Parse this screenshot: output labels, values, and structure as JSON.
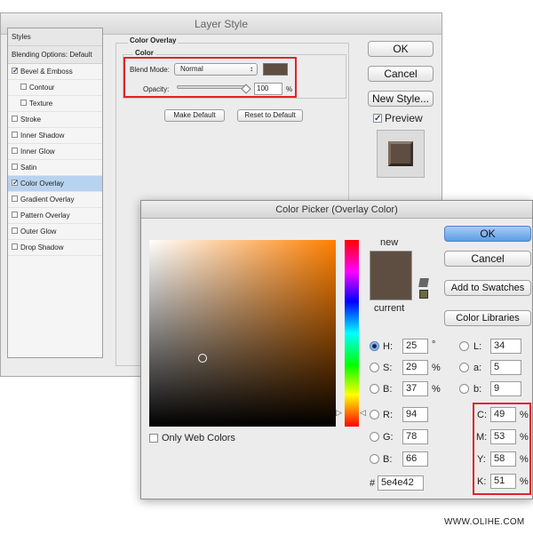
{
  "layer_style": {
    "title": "Layer Style",
    "styles": [
      {
        "label": "Styles",
        "checkbox": false,
        "checked": false,
        "indent": false,
        "selected": false,
        "header": true
      },
      {
        "label": "Blending Options: Default",
        "checkbox": false,
        "checked": false,
        "indent": false,
        "selected": false,
        "header": true
      },
      {
        "label": "Bevel & Emboss",
        "checkbox": true,
        "checked": true,
        "indent": false,
        "selected": false,
        "header": false
      },
      {
        "label": "Contour",
        "checkbox": true,
        "checked": false,
        "indent": true,
        "selected": false,
        "header": false
      },
      {
        "label": "Texture",
        "checkbox": true,
        "checked": false,
        "indent": true,
        "selected": false,
        "header": false
      },
      {
        "label": "Stroke",
        "checkbox": true,
        "checked": false,
        "indent": false,
        "selected": false,
        "header": false
      },
      {
        "label": "Inner Shadow",
        "checkbox": true,
        "checked": false,
        "indent": false,
        "selected": false,
        "header": false
      },
      {
        "label": "Inner Glow",
        "checkbox": true,
        "checked": false,
        "indent": false,
        "selected": false,
        "header": false
      },
      {
        "label": "Satin",
        "checkbox": true,
        "checked": false,
        "indent": false,
        "selected": false,
        "header": false
      },
      {
        "label": "Color Overlay",
        "checkbox": true,
        "checked": true,
        "indent": false,
        "selected": true,
        "header": false
      },
      {
        "label": "Gradient Overlay",
        "checkbox": true,
        "checked": false,
        "indent": false,
        "selected": false,
        "header": false
      },
      {
        "label": "Pattern Overlay",
        "checkbox": true,
        "checked": false,
        "indent": false,
        "selected": false,
        "header": false
      },
      {
        "label": "Outer Glow",
        "checkbox": true,
        "checked": false,
        "indent": false,
        "selected": false,
        "header": false
      },
      {
        "label": "Drop Shadow",
        "checkbox": true,
        "checked": false,
        "indent": false,
        "selected": false,
        "header": false
      }
    ],
    "group_title": "Color Overlay",
    "sub_title": "Color",
    "blend_mode_label": "Blend Mode:",
    "blend_mode_value": "Normal",
    "opacity_label": "Opacity:",
    "opacity_value": "100",
    "opacity_unit": "%",
    "make_default": "Make Default",
    "reset_default": "Reset to Default",
    "ok": "OK",
    "cancel": "Cancel",
    "new_style": "New Style...",
    "preview_label": "Preview",
    "preview_checked": true,
    "overlay_color": "#5e4e42"
  },
  "color_picker": {
    "title": "Color Picker (Overlay Color)",
    "new_label": "new",
    "current_label": "current",
    "ok": "OK",
    "cancel": "Cancel",
    "add_to_swatches": "Add to Swatches",
    "color_libraries": "Color Libraries",
    "only_web_colors": "Only Web Colors",
    "hsb": [
      {
        "label": "H:",
        "value": "25",
        "unit": "°",
        "selected": true
      },
      {
        "label": "S:",
        "value": "29",
        "unit": "%",
        "selected": false
      },
      {
        "label": "B:",
        "value": "37",
        "unit": "%",
        "selected": false
      }
    ],
    "rgb": [
      {
        "label": "R:",
        "value": "94"
      },
      {
        "label": "G:",
        "value": "78"
      },
      {
        "label": "B:",
        "value": "66"
      }
    ],
    "lab": [
      {
        "label": "L:",
        "value": "34"
      },
      {
        "label": "a:",
        "value": "5"
      },
      {
        "label": "b:",
        "value": "9"
      }
    ],
    "cmyk": [
      {
        "label": "C:",
        "value": "49",
        "unit": "%"
      },
      {
        "label": "M:",
        "value": "53",
        "unit": "%"
      },
      {
        "label": "Y:",
        "value": "58",
        "unit": "%"
      },
      {
        "label": "K:",
        "value": "51",
        "unit": "%"
      }
    ],
    "hex_label": "#",
    "hex_value": "5e4e42",
    "current_color": "#5e4e42"
  },
  "watermark": "WWW.OLIHE.COM"
}
